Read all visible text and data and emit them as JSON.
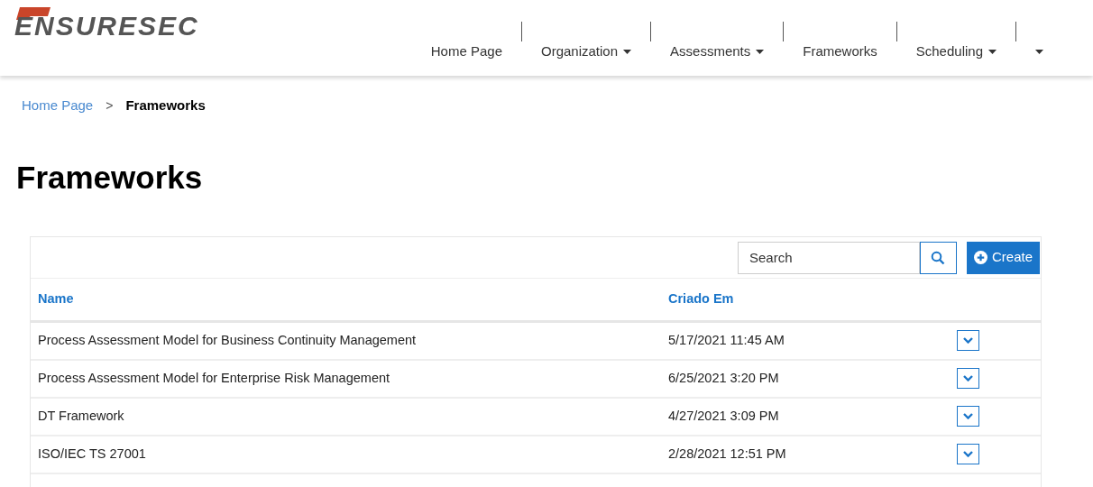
{
  "logo": {
    "text": "ENSURESEC"
  },
  "nav": [
    {
      "label": "Home Page",
      "kind": "link"
    },
    {
      "label": "Organization",
      "kind": "dropdown"
    },
    {
      "label": "Assessments",
      "kind": "dropdown"
    },
    {
      "label": "Frameworks",
      "kind": "link"
    },
    {
      "label": "Scheduling",
      "kind": "dropdown"
    },
    {
      "kind": "dropdown"
    }
  ],
  "breadcrumb": [
    {
      "label": "Home Page",
      "current": false
    },
    {
      "label": "Frameworks",
      "current": true
    }
  ],
  "breadcrumb_separator": ">",
  "page_title": "Frameworks",
  "search": {
    "placeholder": "Search"
  },
  "create_button": "Create",
  "table": {
    "columns": [
      "Name",
      "Criado Em"
    ],
    "rows": [
      [
        "Process Assessment Model for Business Continuity Management",
        "5/17/2021 11:45 AM"
      ],
      [
        "Process Assessment Model for Enterprise Risk Management",
        "6/25/2021 3:20 PM"
      ],
      [
        "DT Framework",
        "4/27/2021 3:09 PM"
      ],
      [
        "ISO/IEC TS 27001",
        "2/28/2021 12:51 PM"
      ]
    ]
  }
}
